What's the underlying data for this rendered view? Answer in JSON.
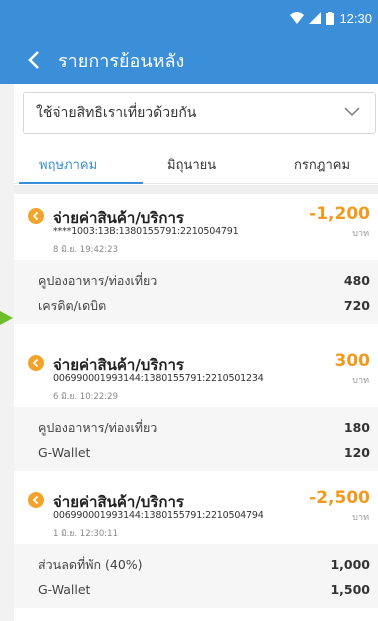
{
  "status_bar": {
    "time": "12:30"
  },
  "header": {
    "title": "รายการย้อนหลัง"
  },
  "filter": {
    "selected": "ใช้จ่ายสิทธิเราเที่ยวด้วยกัน"
  },
  "tabs": [
    {
      "label": "พฤษภาคม",
      "active": true
    },
    {
      "label": "มิถุนายน",
      "active": false
    },
    {
      "label": "กรกฎาคม",
      "active": false
    }
  ],
  "transactions": [
    {
      "title": "จ่ายค่าสินค้า/บริการ",
      "ref": "****1003:13B:1380155791:2210504791",
      "date": "8 มิ.ย. 19:42:23",
      "amount": "-1,200",
      "currency": "บาท",
      "details": [
        {
          "label": "คูปองอาหาร/ท่องเที่ยว",
          "value": "480"
        },
        {
          "label": "เครดิต/เดบิต",
          "value": "720"
        }
      ]
    },
    {
      "title": "จ่ายค่าสินค้า/บริการ",
      "ref": "006990001993144:1380155791:2210501234",
      "date": "6 มิ.ย. 10:22:29",
      "amount": "300",
      "currency": "บาท",
      "details": [
        {
          "label": "คูปองอาหาร/ท่องเที่ยว",
          "value": "180"
        },
        {
          "label": "G-Wallet",
          "value": "120"
        }
      ]
    },
    {
      "title": "จ่ายค่าสินค้า/บริการ",
      "ref": "006990001993144:1380155791:2210504794",
      "date": "1 มิ.ย. 12:30:11",
      "amount": "-2,500",
      "currency": "บาท",
      "details": [
        {
          "label": "ส่วนลดที่พัก (40%)",
          "value": "1,000"
        },
        {
          "label": "G-Wallet",
          "value": "1,500"
        }
      ]
    }
  ],
  "colors": {
    "primary": "#3b8fd9",
    "amount": "#f39a1e",
    "indicator": "#6cbf2a"
  }
}
